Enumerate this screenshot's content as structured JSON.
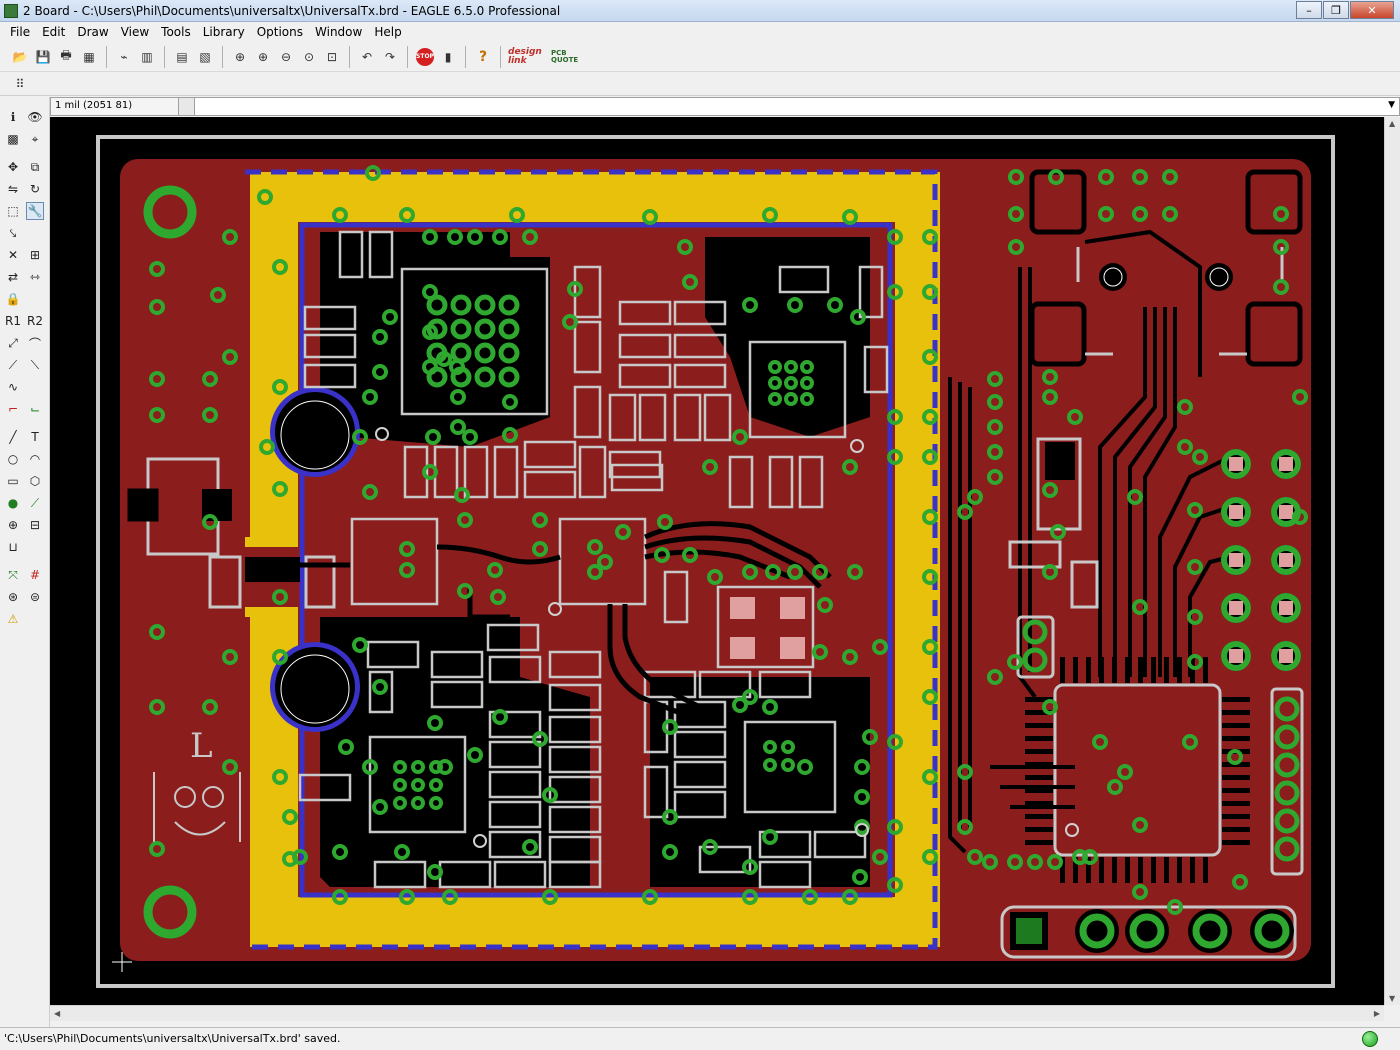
{
  "window": {
    "title": "2 Board - C:\\Users\\Phil\\Documents\\universaltx\\UniversalTx.brd - EAGLE 6.5.0 Professional",
    "minimize": "–",
    "maximize": "❐",
    "close": "✕"
  },
  "menu": [
    "File",
    "Edit",
    "Draw",
    "View",
    "Tools",
    "Library",
    "Options",
    "Window",
    "Help"
  ],
  "toolbar": {
    "stop_label": "STOP",
    "help_label": "?",
    "designlink_label": "design link",
    "pcbquote_label": "PCB QUOTE"
  },
  "coordinate_display": "1 mil (2051 81)",
  "status": "'C:\\Users\\Phil\\Documents\\universaltx\\UniversalTx.brd' saved.",
  "board": {
    "silkscreen_text": "L",
    "colors": {
      "background": "#000000",
      "board_outline": "#c8c8c8",
      "copper": "#8b1d1d",
      "trace": "#000000",
      "shield": "#e8c10c",
      "shield_edge": "#3a32c8",
      "via": "#2fa82f",
      "silk": "#c8c8c8",
      "pad": "#e0a0a0"
    }
  }
}
